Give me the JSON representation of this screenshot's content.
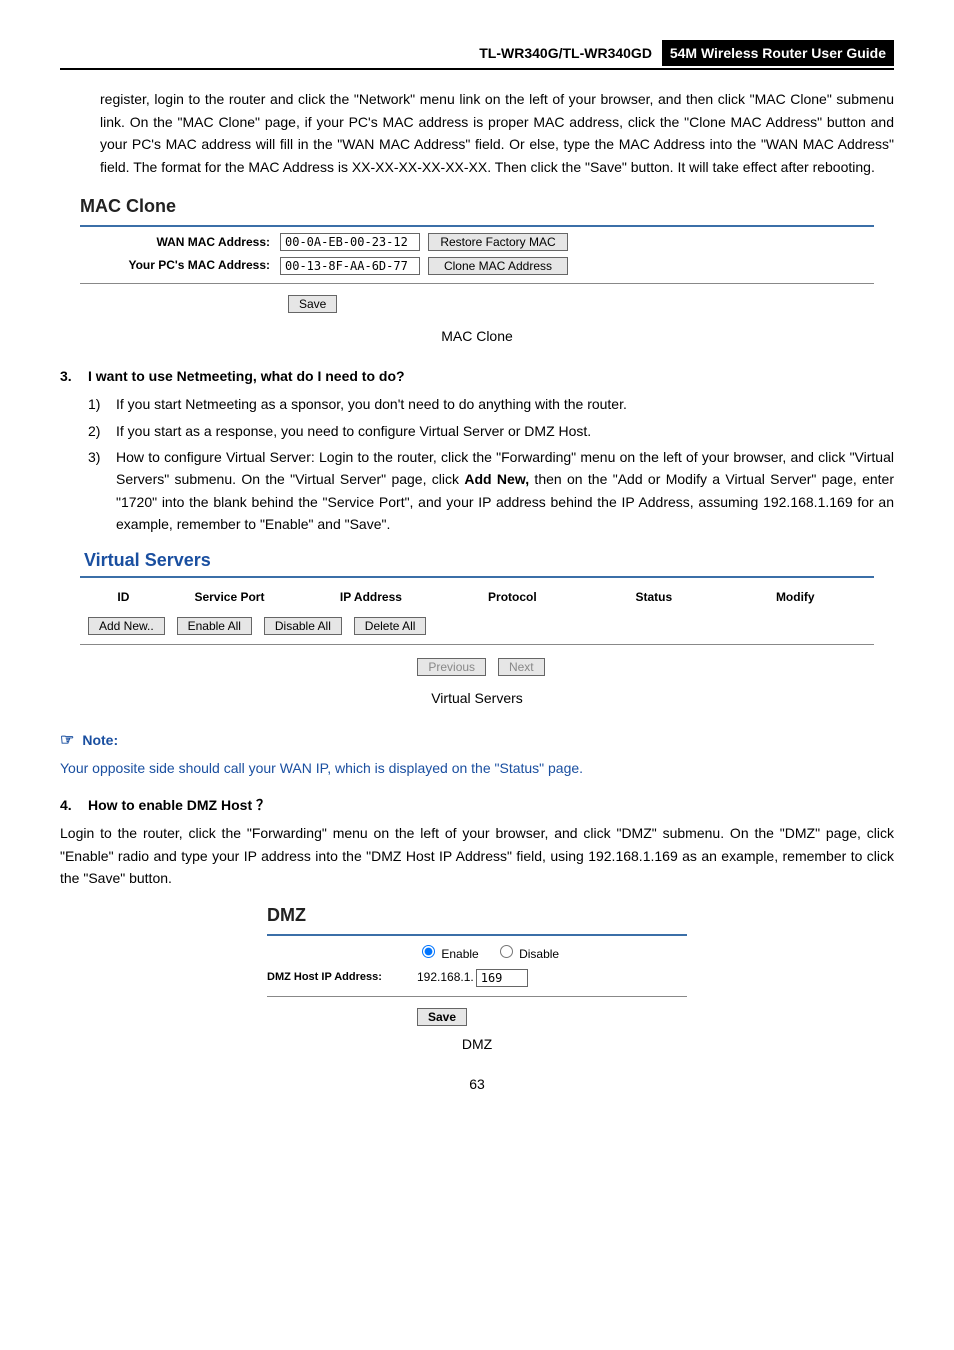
{
  "header": {
    "model": "TL-WR340G/TL-WR340GD",
    "title": "54M Wireless Router User Guide"
  },
  "intro_para": "register, login to the router and click the \"Network\" menu link on the left of your browser, and then click \"MAC Clone\" submenu link. On the \"MAC Clone\" page, if your PC's MAC address is proper MAC address, click the \"Clone MAC Address\" button and your PC's MAC address will fill in the \"WAN MAC Address\" field. Or else, type the MAC Address into the \"WAN MAC Address\" field. The format for the MAC Address is XX-XX-XX-XX-XX-XX. Then click the \"Save\" button. It will take effect after rebooting.",
  "mac_clone": {
    "title": "MAC Clone",
    "wan_label": "WAN MAC Address:",
    "wan_value": "00-0A-EB-00-23-12",
    "restore_btn": "Restore Factory MAC",
    "pc_label": "Your PC's MAC Address:",
    "pc_value": "00-13-8F-AA-6D-77",
    "clone_btn": "Clone MAC Address",
    "save_btn": "Save",
    "caption": "MAC Clone"
  },
  "q3": {
    "num": "3.",
    "text": "I want to use Netmeeting, what do I need to do?",
    "items": [
      {
        "n": "1)",
        "t": "If you start Netmeeting as a sponsor, you don't need to do anything with the router."
      },
      {
        "n": "2)",
        "t": "If you start as a response, you need to configure Virtual Server or DMZ Host."
      },
      {
        "n": "3)",
        "t_pre": "How to configure Virtual Server: Login to the router, click the \"Forwarding\" menu on the left of your browser, and click \"Virtual Servers\" submenu. On the \"Virtual Server\" page, click ",
        "t_bold": "Add New,",
        "t_post": " then on the \"Add or Modify a Virtual Server\" page,  enter \"1720\" into the blank behind the \"Service Port\", and your IP address behind the IP Address, assuming 192.168.1.169 for an example, remember to \"Enable\" and \"Save\"."
      }
    ]
  },
  "virtual_servers": {
    "title": "Virtual Servers",
    "cols": [
      "ID",
      "Service Port",
      "IP Address",
      "Protocol",
      "Status",
      "Modify"
    ],
    "buttons": [
      "Add New..",
      "Enable All",
      "Disable All",
      "Delete All"
    ],
    "nav": [
      "Previous",
      "Next"
    ],
    "caption": "Virtual Servers"
  },
  "note": {
    "label": "Note:",
    "body": "Your opposite side should call your WAN IP, which is displayed on the \"Status\" page."
  },
  "q4": {
    "num": "4.",
    "text": "How to enable DMZ Host ？",
    "body": "Login to the router, click the \"Forwarding\" menu on the left of your browser, and click \"DMZ\" submenu. On the \"DMZ\" page, click \"Enable\" radio and type your IP address into the \"DMZ Host IP Address\" field, using 192.168.1.169 as an example, remember to click the \"Save\" button."
  },
  "dmz": {
    "title": "DMZ",
    "enable": "Enable",
    "disable": "Disable",
    "host_label": "DMZ Host IP Address:",
    "prefix": "192.168.1.",
    "value": "169",
    "save_btn": "Save",
    "caption": "DMZ"
  },
  "page_num": "63"
}
